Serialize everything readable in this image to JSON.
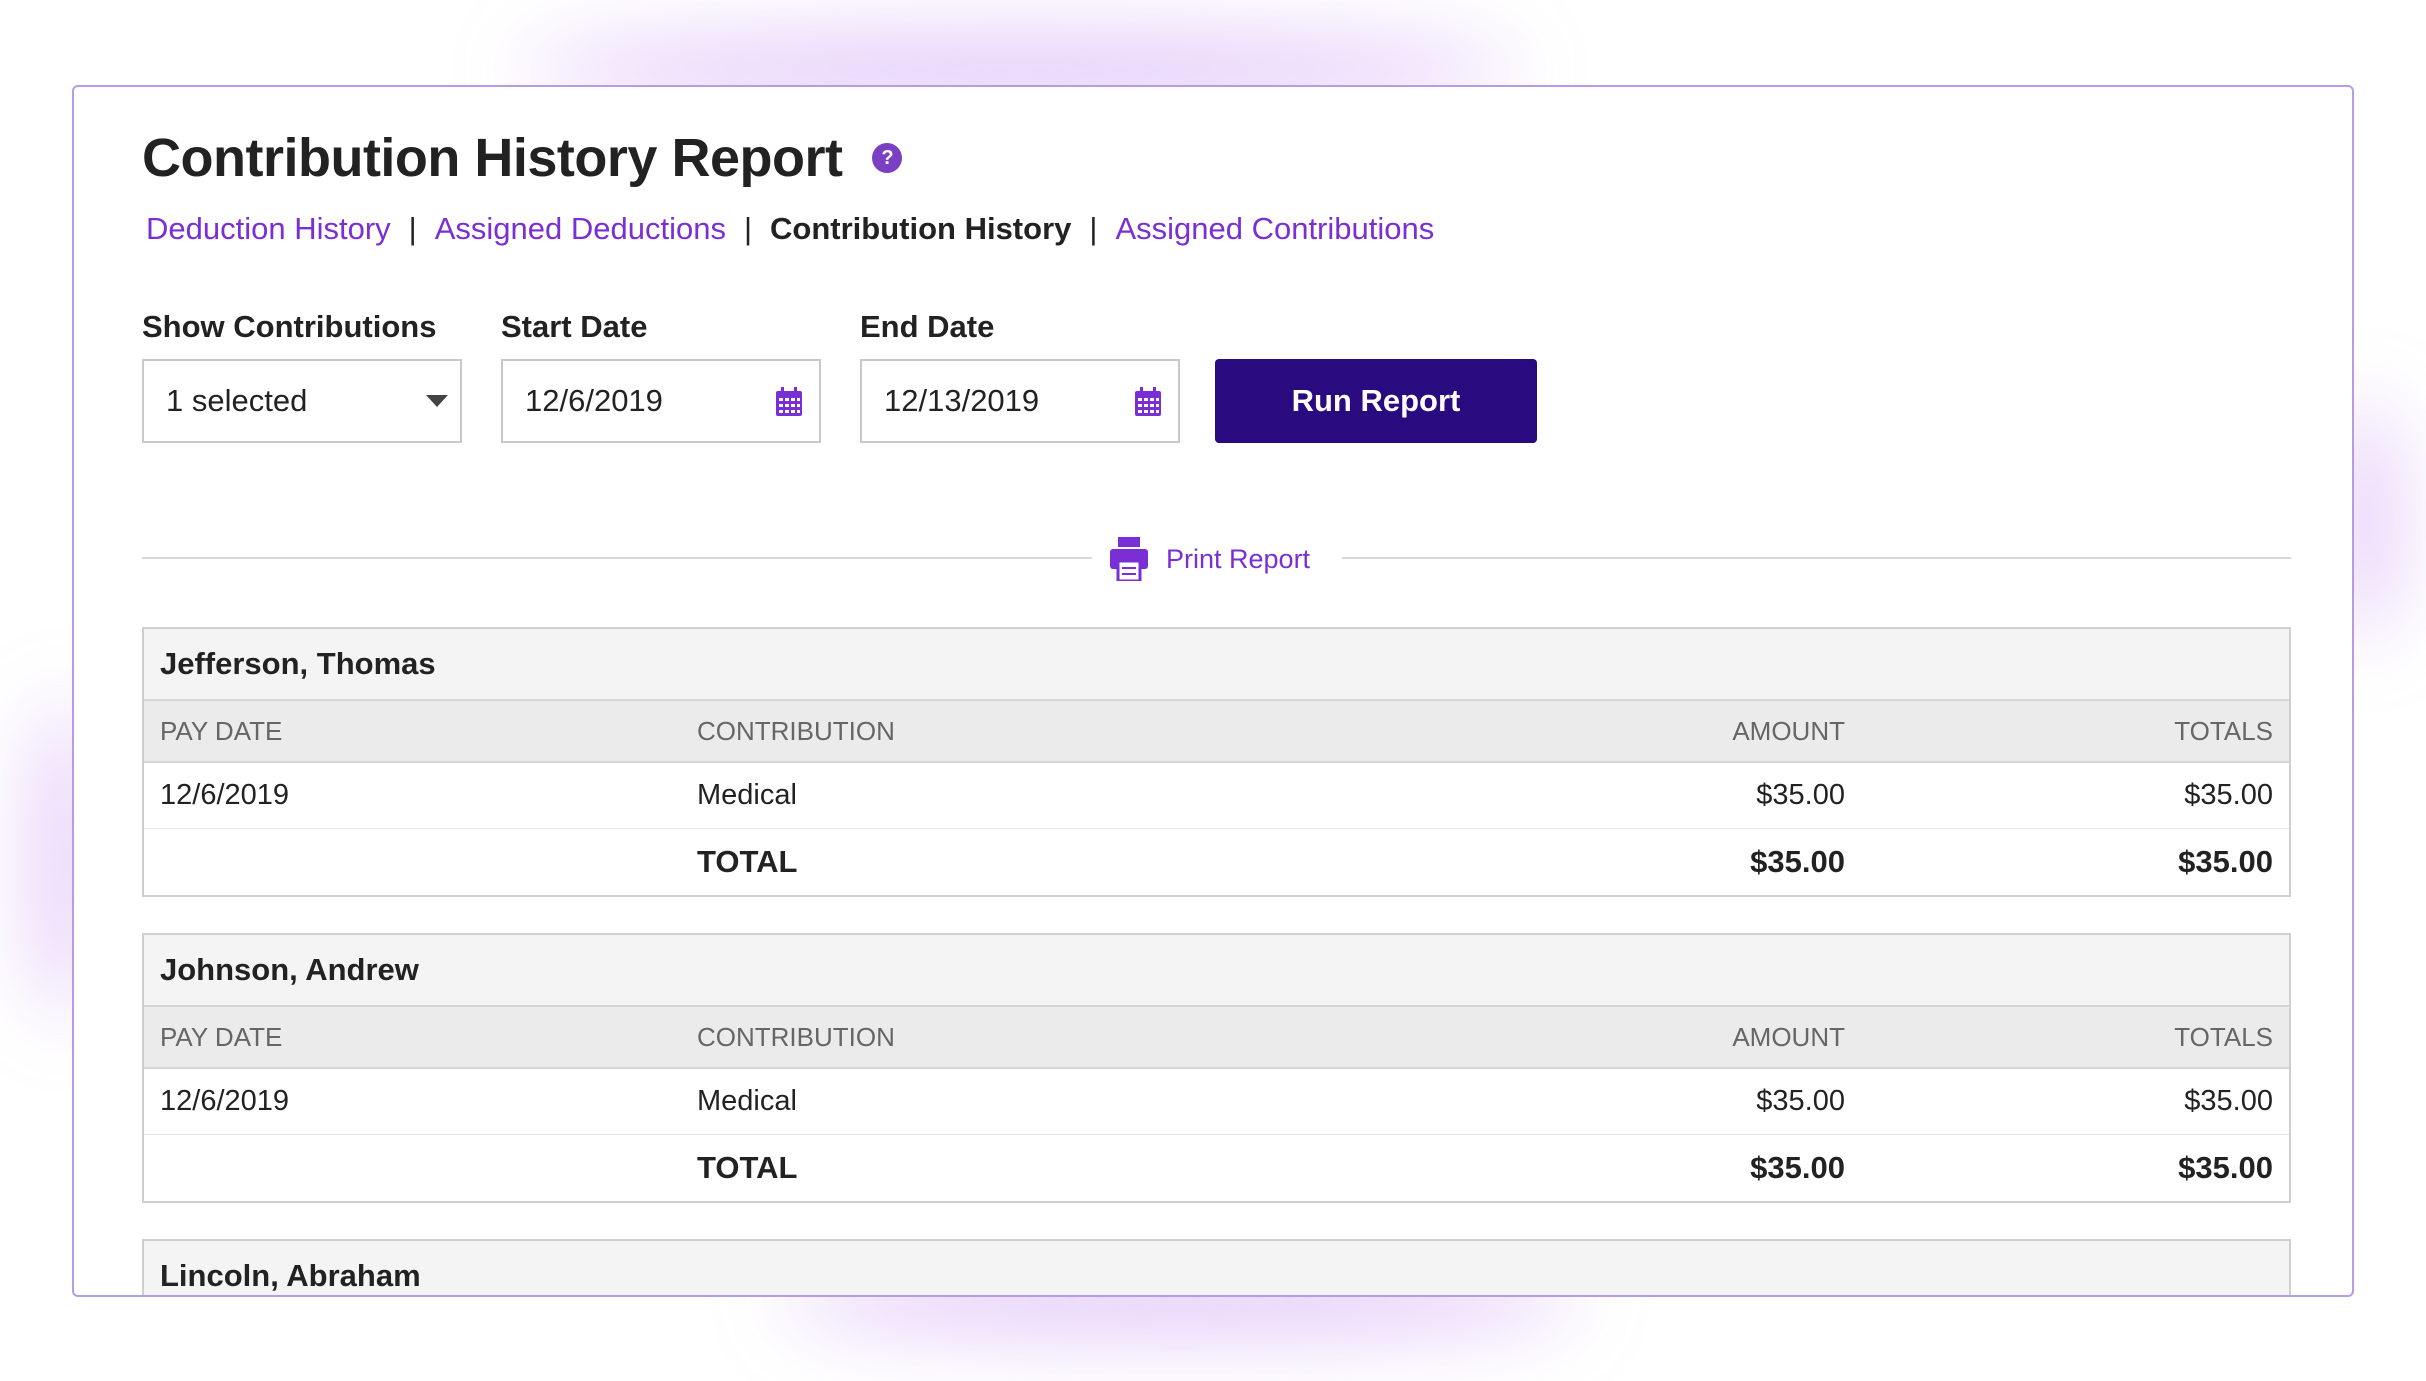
{
  "page": {
    "title": "Contribution History Report",
    "help_icon": "question-circle-icon"
  },
  "subnav": [
    {
      "label": "Deduction History",
      "current": false
    },
    {
      "label": "Assigned Deductions",
      "current": false
    },
    {
      "label": "Contribution History",
      "current": true
    },
    {
      "label": "Assigned Contributions",
      "current": false
    }
  ],
  "filters": {
    "show_label": "Show Contributions",
    "show_value": "1 selected",
    "start_label": "Start Date",
    "start_value": "12/6/2019",
    "end_label": "End Date",
    "end_value": "12/13/2019",
    "run_label": "Run Report"
  },
  "print": {
    "label": "Print Report",
    "icon": "printer-icon"
  },
  "columns": [
    "PAY DATE",
    "CONTRIBUTION",
    "AMOUNT",
    "TOTALS"
  ],
  "employees": [
    {
      "name": "Jefferson, Thomas",
      "rows": [
        {
          "pay_date": "12/6/2019",
          "contribution": "Medical",
          "amount": "$35.00",
          "totals": "$35.00"
        }
      ],
      "total": {
        "label": "TOTAL",
        "amount": "$35.00",
        "totals": "$35.00"
      }
    },
    {
      "name": "Johnson, Andrew",
      "rows": [
        {
          "pay_date": "12/6/2019",
          "contribution": "Medical",
          "amount": "$35.00",
          "totals": "$35.00"
        }
      ],
      "total": {
        "label": "TOTAL",
        "amount": "$35.00",
        "totals": "$35.00"
      }
    },
    {
      "name": "Lincoln, Abraham"
    }
  ],
  "colors": {
    "accent": "#7a2fd6",
    "button": "#2a0a7f",
    "border": "#b79be8"
  }
}
